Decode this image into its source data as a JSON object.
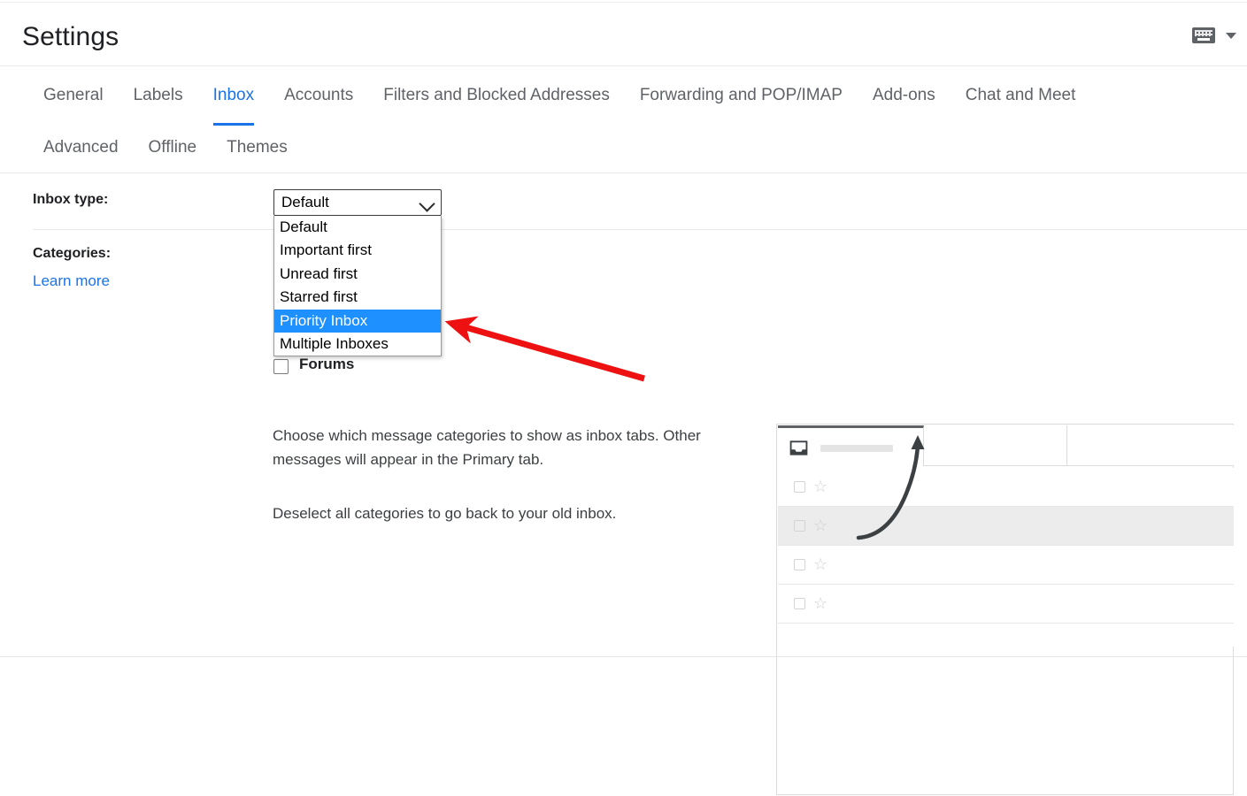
{
  "header": {
    "title": "Settings",
    "ime_icon": "keyboard-icon",
    "ime_caret_icon": "caret-down-icon"
  },
  "tabs": {
    "row1": [
      {
        "label": "General",
        "active": false
      },
      {
        "label": "Labels",
        "active": false
      },
      {
        "label": "Inbox",
        "active": true
      },
      {
        "label": "Accounts",
        "active": false
      },
      {
        "label": "Filters and Blocked Addresses",
        "active": false
      },
      {
        "label": "Forwarding and POP/IMAP",
        "active": false
      },
      {
        "label": "Add-ons",
        "active": false
      },
      {
        "label": "Chat and Meet",
        "active": false
      }
    ],
    "row2": [
      {
        "label": "Advanced",
        "active": false
      },
      {
        "label": "Offline",
        "active": false
      },
      {
        "label": "Themes",
        "active": false
      }
    ]
  },
  "settings": {
    "inbox_type_label": "Inbox type:",
    "categories_label": "Categories:",
    "learn_more_label": "Learn more",
    "inbox_type_select": {
      "value": "Default",
      "expanded": true,
      "chevron_icon": "chevron-down-icon",
      "options": [
        {
          "label": "Default",
          "selected": false
        },
        {
          "label": "Important first",
          "selected": false
        },
        {
          "label": "Unread first",
          "selected": false
        },
        {
          "label": "Starred first",
          "selected": false
        },
        {
          "label": "Priority Inbox",
          "selected": true
        },
        {
          "label": "Multiple Inboxes",
          "selected": false
        }
      ]
    },
    "categories": [
      {
        "label": "",
        "checked": false,
        "occluded": true
      },
      {
        "label": "",
        "checked": false,
        "occluded": true
      },
      {
        "label": "",
        "checked": false,
        "occluded": true
      },
      {
        "label": "Forums",
        "checked": false,
        "occluded": false
      }
    ],
    "description_1": "Choose which message categories to show as inbox tabs. Other messages will appear in the Primary tab.",
    "description_2": "Deselect all categories to go back to your old inbox."
  },
  "preview": {
    "tab_icons": [
      "inbox-tray-icon",
      "people-icon"
    ],
    "rows": [
      {
        "checkbox_icon": "checkbox-icon",
        "star_icon": "star-outline-icon",
        "highlighted": false
      },
      {
        "checkbox_icon": "checkbox-icon",
        "star_icon": "star-outline-icon",
        "highlighted": true
      },
      {
        "checkbox_icon": "checkbox-icon",
        "star_icon": "star-outline-icon",
        "highlighted": false
      },
      {
        "checkbox_icon": "checkbox-icon",
        "star_icon": "star-outline-icon",
        "highlighted": false
      }
    ],
    "star_glyph": "☆",
    "arrow_icon": "curved-up-arrow-icon"
  },
  "annotation": {
    "arrow_icon": "red-arrow-icon",
    "color": "#ee1111",
    "points_to": "Priority Inbox"
  },
  "colors": {
    "accent": "#1a73e8",
    "text": "#202124",
    "muted": "#5f6368",
    "select_highlight": "#1e90ff",
    "annotation_red": "#ee1111"
  }
}
